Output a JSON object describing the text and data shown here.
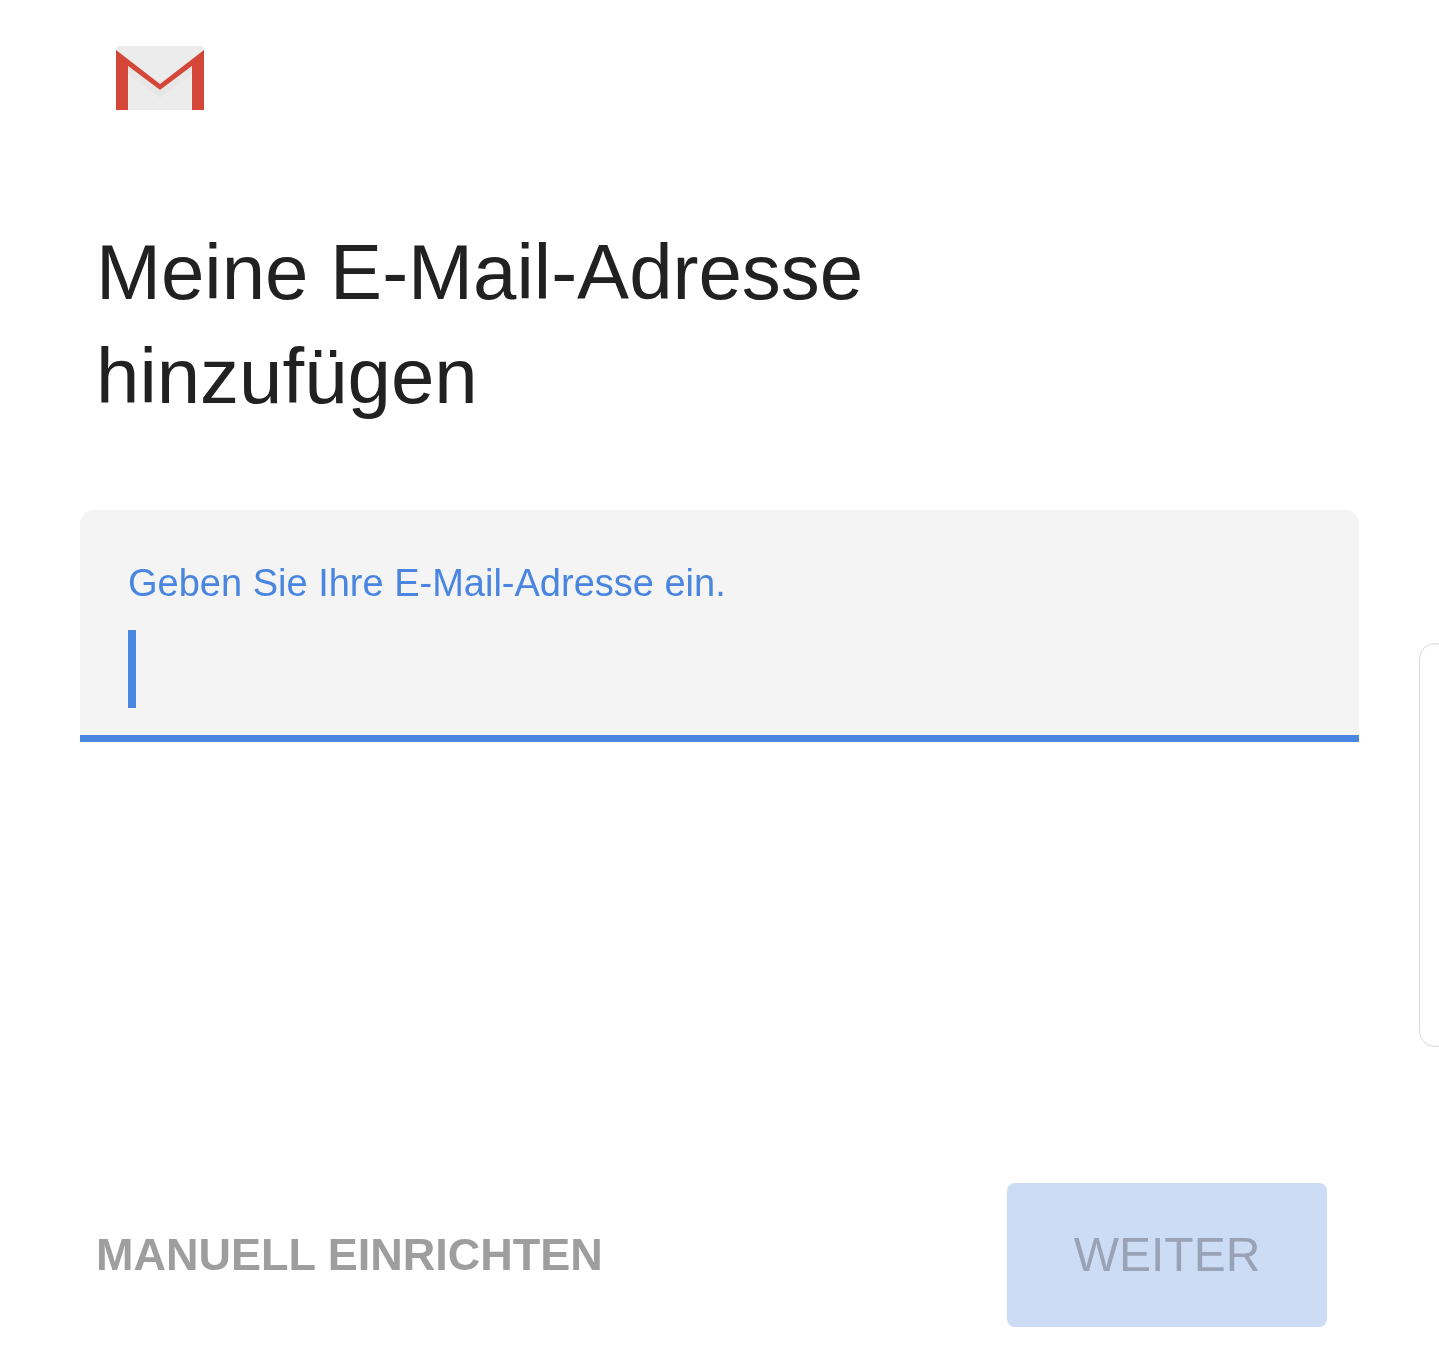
{
  "title": "Meine E-Mail-Adresse hinzufügen",
  "email_field": {
    "label": "Geben Sie Ihre E-Mail-Adresse ein.",
    "focused": true
  },
  "buttons": [
    {
      "label": "MANUELL EINRICHTEN",
      "kind": "text",
      "disabled": false
    },
    {
      "label": "WEITER",
      "kind": "filled",
      "disabled": true
    }
  ]
}
